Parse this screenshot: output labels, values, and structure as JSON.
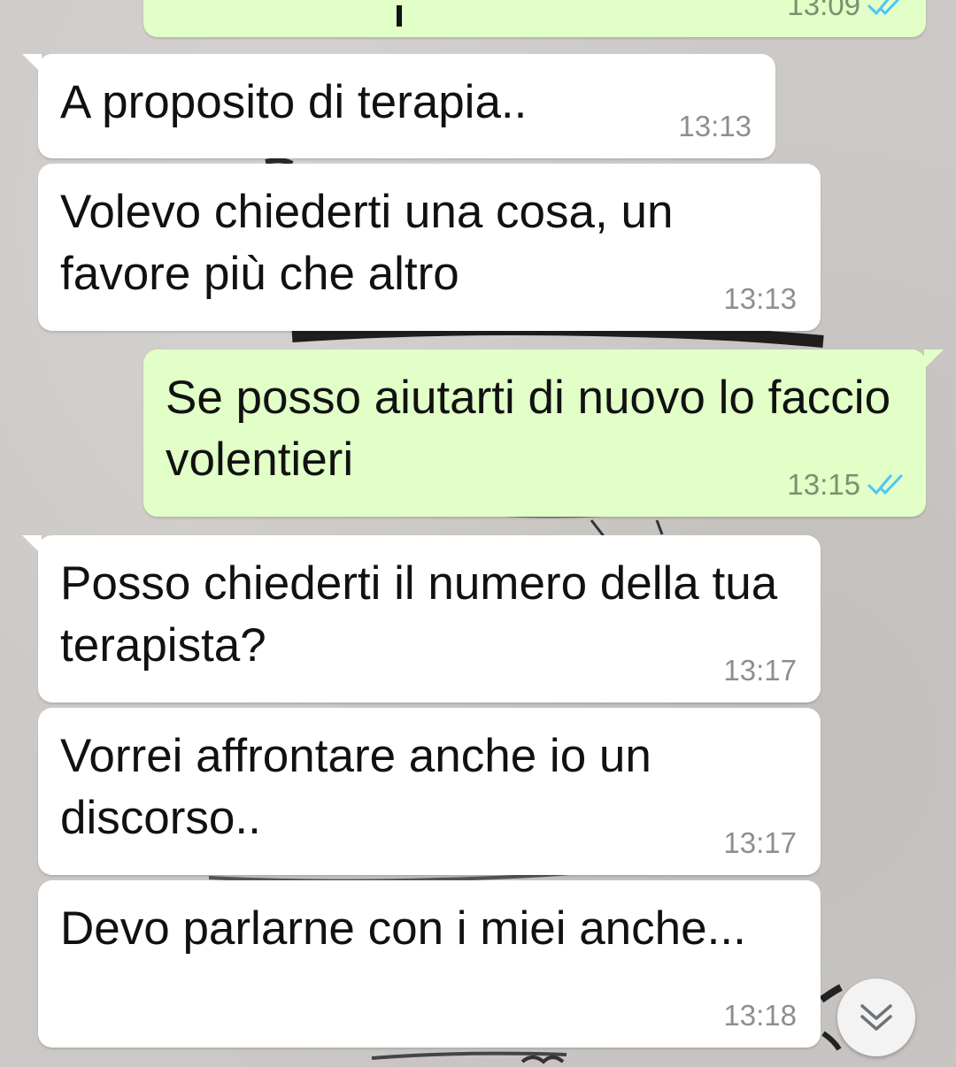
{
  "chat": {
    "messages": [
      {
        "direction": "out",
        "text": "",
        "time": "13:09",
        "status": "read"
      },
      {
        "direction": "in",
        "text": "A proposito di terapia..",
        "time": "13:13"
      },
      {
        "direction": "in",
        "text": "Volevo chiederti una cosa, un favore più che altro",
        "time": "13:13"
      },
      {
        "direction": "out",
        "text": "Se posso aiutarti di nuovo lo faccio volentieri",
        "time": "13:15",
        "status": "read"
      },
      {
        "direction": "in",
        "text": "Posso chiederti il numero della tua terapista?",
        "time": "13:17"
      },
      {
        "direction": "in",
        "text": "Vorrei affrontare anche io un discorso..",
        "time": "13:17"
      },
      {
        "direction": "in",
        "text": "Devo parlarne con i miei anche...",
        "time": "13:18"
      }
    ]
  },
  "icons": {
    "read_receipt": "double-check-icon",
    "scroll_down": "chevron-double-down-icon"
  },
  "colors": {
    "incoming_bubble": "#ffffff",
    "outgoing_bubble": "#e1ffc7",
    "read_ticks": "#4fc3f7",
    "timestamp": "#8b8f93",
    "wallpaper": "#cbc8c5"
  }
}
